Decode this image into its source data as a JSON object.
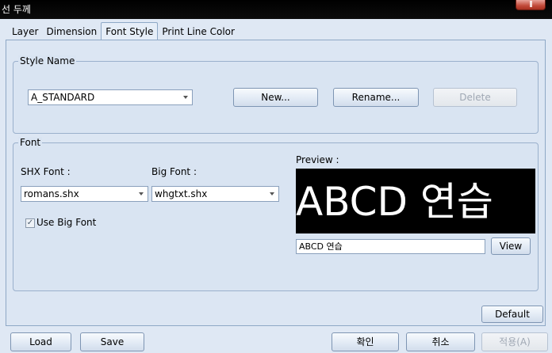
{
  "window": {
    "title": "선 두께"
  },
  "tabs": [
    {
      "label": "Layer"
    },
    {
      "label": "Dimension"
    },
    {
      "label": "Font Style"
    },
    {
      "label": "Print Line Color"
    }
  ],
  "style_name": {
    "group_label": "Style Name",
    "selected": "A_STANDARD",
    "new_label": "New...",
    "rename_label": "Rename...",
    "delete_label": "Delete"
  },
  "font": {
    "group_label": "Font",
    "shx_label": "SHX Font :",
    "shx_value": "romans.shx",
    "big_label": "Big Font :",
    "big_value": "whgtxt.shx",
    "use_big_font_label": "Use Big Font",
    "use_big_font_checked": true,
    "preview_label": "Preview :",
    "preview_text": "ABCD 연습",
    "preview_input": "ABCD 연습",
    "view_label": "View"
  },
  "footer": {
    "default_label": "Default",
    "load_label": "Load",
    "save_label": "Save",
    "ok_label": "확인",
    "cancel_label": "취소",
    "apply_label": "적용(A)"
  }
}
